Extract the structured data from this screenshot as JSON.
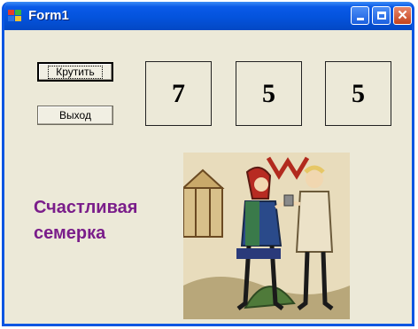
{
  "window": {
    "title": "Form1",
    "title_color": "#ffffff",
    "titlebar_color": "#0453dc"
  },
  "controls": {
    "spin_label": "Крутить",
    "exit_label": "Выход"
  },
  "digits": [
    "7",
    "5",
    "5"
  ],
  "caption": {
    "line1": "Счастливая",
    "line2": "семерка",
    "color": "#7a1d8a"
  },
  "picture": {
    "icon": "medieval-illustration"
  }
}
